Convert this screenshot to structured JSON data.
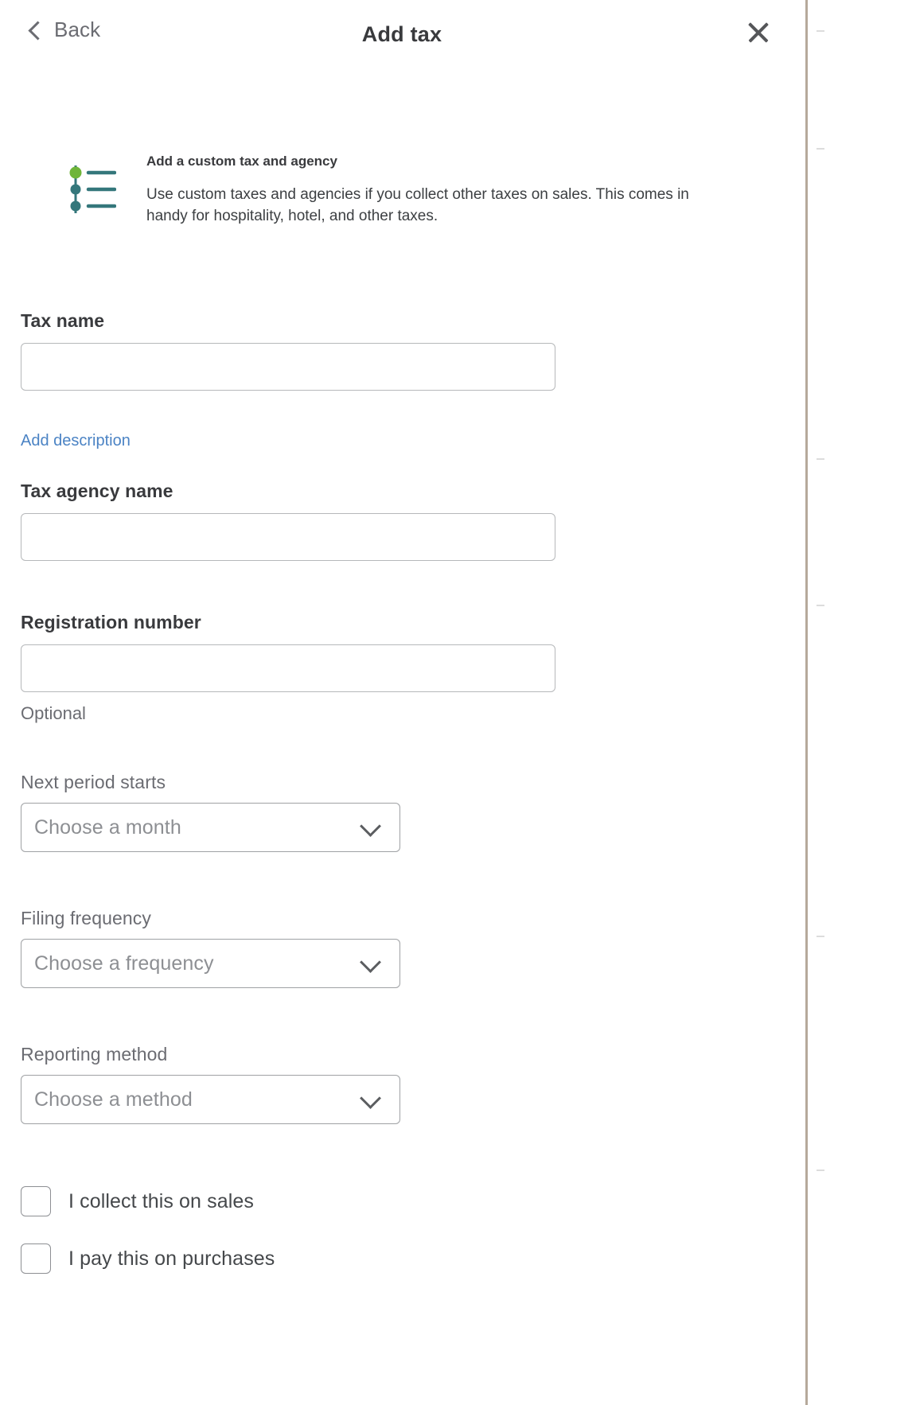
{
  "header": {
    "back_label": "Back",
    "title": "Add tax",
    "back_icon": "chevron-left-icon",
    "close_icon": "close-icon"
  },
  "intro": {
    "icon": "list-settings-icon",
    "heading": "Add a custom tax and agency",
    "body": "Use custom taxes and agencies if you collect other taxes on sales. This comes in handy for hospitality, hotel, and other taxes."
  },
  "form": {
    "tax_name": {
      "label": "Tax name",
      "value": "",
      "placeholder": ""
    },
    "add_description_link": "Add description",
    "tax_agency_name": {
      "label": "Tax agency name",
      "value": "",
      "placeholder": ""
    },
    "registration_number": {
      "label": "Registration number",
      "value": "",
      "placeholder": "",
      "helper": "Optional"
    },
    "next_period_starts": {
      "label": "Next period starts",
      "selected": "Choose a month",
      "chevron_icon": "chevron-down-icon"
    },
    "filing_frequency": {
      "label": "Filing frequency",
      "selected": "Choose a frequency",
      "chevron_icon": "chevron-down-icon"
    },
    "reporting_method": {
      "label": "Reporting method",
      "selected": "Choose a method",
      "chevron_icon": "chevron-down-icon"
    },
    "checkboxes": [
      {
        "label": "I collect this on sales",
        "checked": false
      },
      {
        "label": "I pay this on purchases",
        "checked": false
      }
    ]
  },
  "colors": {
    "link": "#4b83c4",
    "icon_green": "#6fb539",
    "icon_teal": "#34777b",
    "text_primary": "#393a3d",
    "text_muted": "#6b6c72",
    "border": "#b6b8ba"
  }
}
